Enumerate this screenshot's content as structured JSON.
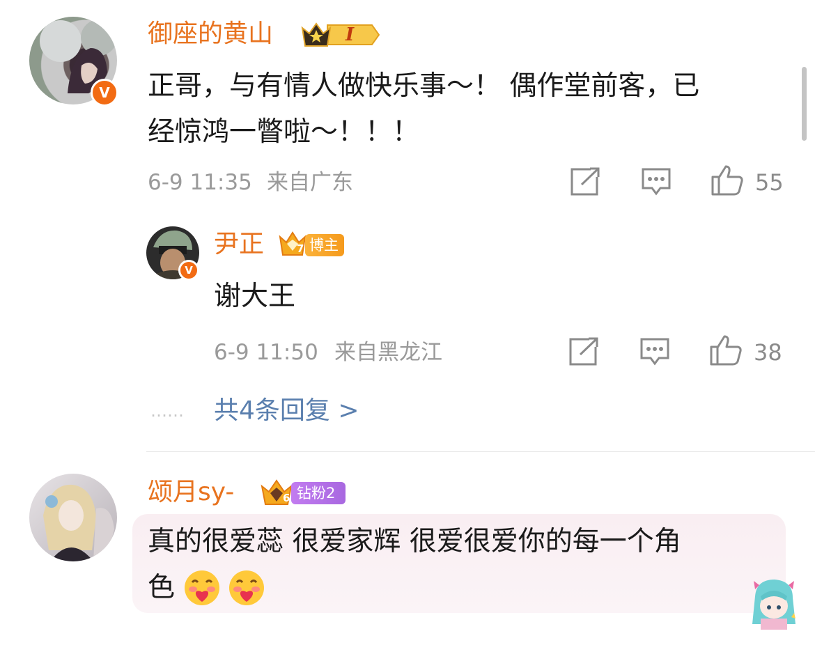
{
  "comments": [
    {
      "username": "御座的黄山",
      "badge": {
        "icon": "crown-star-icon",
        "level": "I"
      },
      "verified": "V",
      "lines": [
        "正哥，与有情人做快乐事～！ 偶作堂前客，已",
        "经惊鸿一瞥啦～！！！"
      ],
      "time": "6-9 11:35",
      "location": "来自广东",
      "likes": "55",
      "reply": {
        "username": "尹正",
        "badge": {
          "icon": "crown-level-icon",
          "level": "7",
          "label": "博主"
        },
        "verified": "V",
        "lines": [
          "谢大王"
        ],
        "time": "6-9 11:50",
        "location": "来自黑龙江",
        "likes": "38"
      },
      "more_replies": {
        "dots": "……",
        "text": "共4条回复 >"
      }
    },
    {
      "username": "颂月sy-",
      "badge": {
        "icon": "crown-level-icon",
        "level": "6",
        "label": "钻粉2"
      },
      "lines": [
        "真的很爱蕊 很爱家辉 很爱很爱你的每一个角",
        "色"
      ],
      "emoji": [
        "hug-face-emoji",
        "hug-face-emoji"
      ],
      "sticker": "anime-girl-sticker"
    }
  ],
  "colors": {
    "username": "#e8731f",
    "link": "#5a7fae",
    "meta": "#9a9a9a",
    "verified": "#f26b13",
    "fan_badge": "#b173e6",
    "blogger_badge": "#f59a1c"
  }
}
